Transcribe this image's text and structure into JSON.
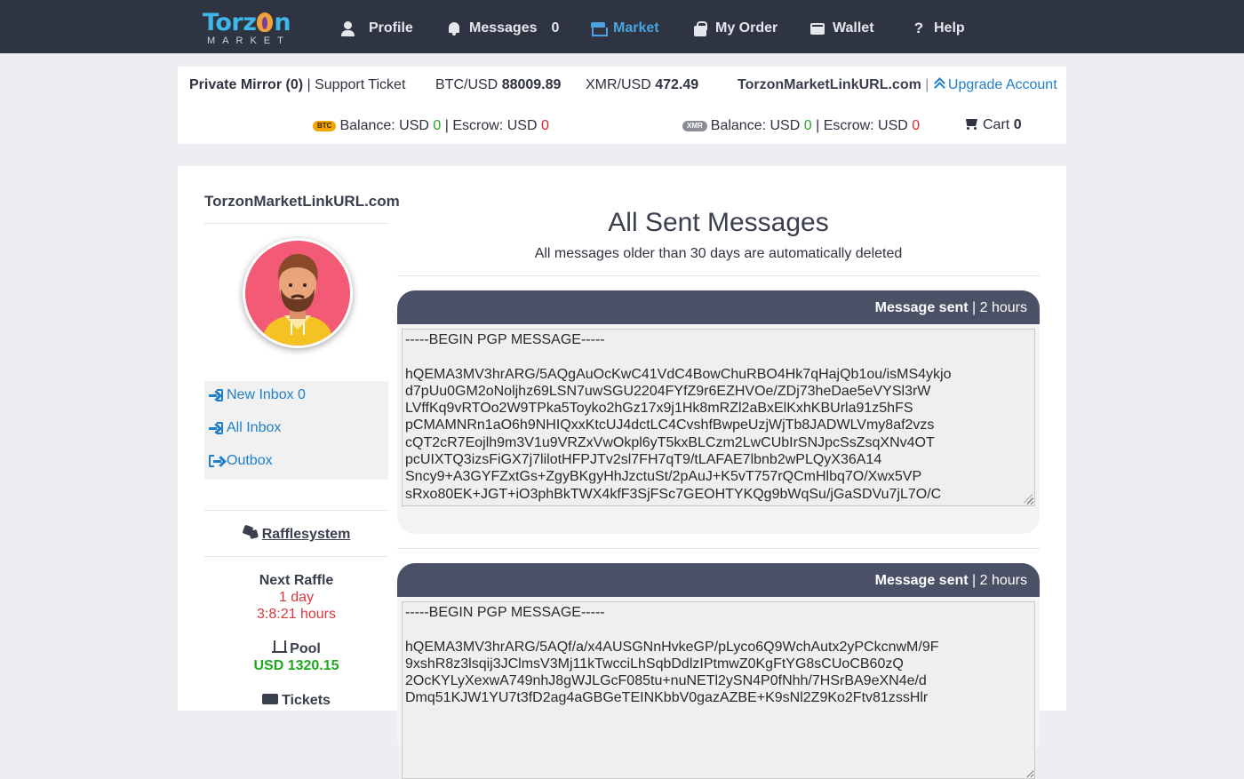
{
  "logo": {
    "title_part1": "Torz",
    "title_part2": "n",
    "subtitle": "MARKET"
  },
  "nav": {
    "profile": "Profile",
    "messages": "Messages",
    "messages_count": "0",
    "market": "Market",
    "my_order": "My Order",
    "wallet": "Wallet",
    "help": "Help"
  },
  "infobar": {
    "private_mirror": "Private Mirror (0)",
    "separator": "|",
    "support_ticket": "Support Ticket",
    "btc_usd_label": "BTC/USD",
    "btc_usd_value": "88009.89",
    "xmr_usd_label": "XMR/USD",
    "xmr_usd_value": "472.49",
    "site_link": "TorzonMarketLinkURL.com",
    "upgrade": "Upgrade Account",
    "btc_pill": "BTC",
    "xmr_pill": "XMR",
    "balance_label": "Balance: USD",
    "escrow_label": "Escrow: USD",
    "btc_balance": "0",
    "btc_escrow": "0",
    "xmr_balance": "0",
    "xmr_escrow": "0",
    "cart_label": "Cart",
    "cart_count": "0"
  },
  "sidebar": {
    "site": "TorzonMarketLinkURL.com",
    "menu": [
      {
        "label": "New Inbox 0"
      },
      {
        "label": "All Inbox"
      },
      {
        "label": "Outbox"
      }
    ],
    "raffle_link": "Rafflesystem",
    "next_raffle_label": "Next Raffle",
    "next_raffle_days": "1 day",
    "next_raffle_time": "3:8:21 hours",
    "pool_label": "Pool",
    "pool_value": "USD 1320.15",
    "tickets_label": "Tickets"
  },
  "page": {
    "title": "All Sent Messages",
    "subtitle": "All messages older than 30 days are automatically deleted"
  },
  "messages": [
    {
      "status": "Message sent",
      "age": "2 hours",
      "body": "-----BEGIN PGP MESSAGE-----\n\nhQEMA3MV3hrARG/5AQgAuOcKwC41VdC4BowChuRBO4Hk7qHajQb1ou/isMS4ykjo\nd7pUu0GM2oNoljhz69LSN7uwSGU2204FYfZ9r6EZHVOe/ZDj73heDae5eVYSl3rW\nLVffKq9vRTOo2W9TPka5Toyko2hGz17x9j1Hk8mRZl2aBxElKxhKBUrla91z5hFS\npCMAMNRn1aO6h9NHIQxxKtcUJ4dctLC4CvshfBwpeUzjWjTb8JADWLVmy8af2vzs\ncQT2cR7Eojlh9m3V1u9VRZxVwOkpl6yT5kxBLCzm2LwCUbIrSNJpcSsZsqXNv4OT\npcUIXTQ3izsFiGX7j7lilotHFPJTv2sl7FH7qT9/tLAFAE7lbnb2wPLQyX36A14\nSncy9+A3GYFZxtGs+ZgyBKgyHhJzctuSt/2pAuJ+K5vT757rQCmHlbq7O/Xwx5VP\nsRxo80EK+JGT+iO3phBkTWX4kfF3SjFSc7GEOHTYKQg9bWqSu/jGaSDVu7jL7O/C"
    },
    {
      "status": "Message sent",
      "age": "2 hours",
      "body": "-----BEGIN PGP MESSAGE-----\n\nhQEMA3MV3hrARG/5AQf/a/x4AUSGNnHvkeGP/pLyco6Q9WchAutx2yPCkcnwM/9F\n9xshR8z3lsqij3JClmsV3Mj11kTwcciLhSqbDdlzIPtmwZ0KgFtYG8sCUoCB60zQ\n2OcKYLyXexwA749nhJ8gWJLGcF085tu+nuNETl2ySN4P0fNhh/7HSrBA9eXN4e/d\nDmq51KJW1YU7t3fD2ag4aGBGeTEINKbbV0gazAZBE+K9sNl2Z9Ko2Ftv81zssHlr"
    }
  ],
  "colors": {
    "nav_bg": "#2e3442",
    "accent": "#4aa3df",
    "link": "#1f7fc9",
    "message_header": "#4a5066",
    "positive": "#2ca02c",
    "negative": "#e02424"
  }
}
